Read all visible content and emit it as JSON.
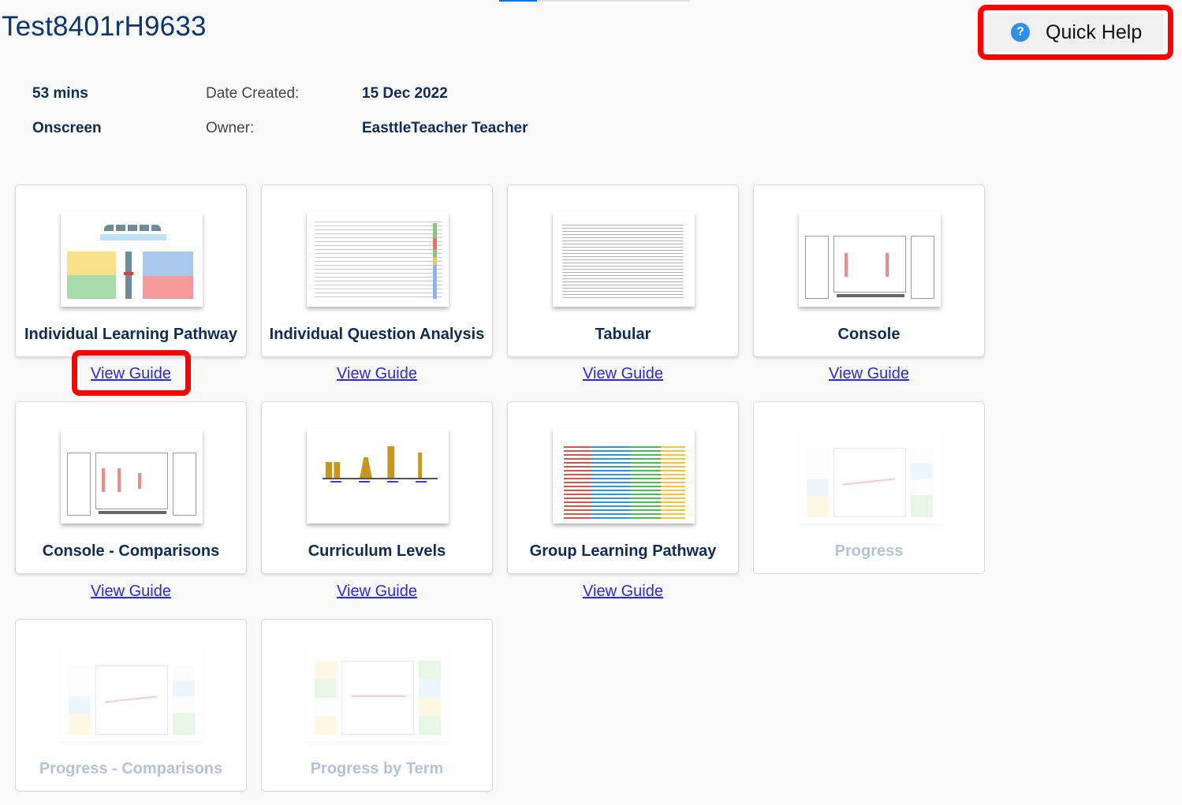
{
  "loading_bar": {
    "progress_percent": 20,
    "track_color": "#e2e2e2",
    "fill_color": "#0a74da"
  },
  "header": {
    "title": "Test8401rH9633"
  },
  "quick_help": {
    "label": "Quick Help",
    "icon": "question-circle-icon",
    "highlight_color": "#ff0000"
  },
  "details": {
    "duration": "53 mins",
    "mode": "Onscreen",
    "date_created_label": "Date Created:",
    "date_created_value": "15 Dec 2022",
    "owner_label": "Owner:",
    "owner_value": "EasttleTeacher Teacher"
  },
  "reports": [
    {
      "title": "Individual Learning Pathway",
      "guide": "View Guide",
      "enabled": true,
      "highlighted": true
    },
    {
      "title": "Individual Question Analysis",
      "guide": "View Guide",
      "enabled": true
    },
    {
      "title": "Tabular",
      "guide": "View Guide",
      "enabled": true
    },
    {
      "title": "Console",
      "guide": "View Guide",
      "enabled": true
    },
    {
      "title": "Console - Comparisons",
      "guide": "View Guide",
      "enabled": true
    },
    {
      "title": "Curriculum Levels",
      "guide": "View Guide",
      "enabled": true
    },
    {
      "title": "Group Learning Pathway",
      "guide": "View Guide",
      "enabled": true
    },
    {
      "title": "Progress",
      "enabled": false
    },
    {
      "title": "Progress - Comparisons",
      "enabled": false
    },
    {
      "title": "Progress by Term",
      "enabled": false
    }
  ],
  "colors": {
    "title_text": "#0d2c5a",
    "disabled_text": "#b3c3db",
    "link": "#2a2ae8"
  }
}
